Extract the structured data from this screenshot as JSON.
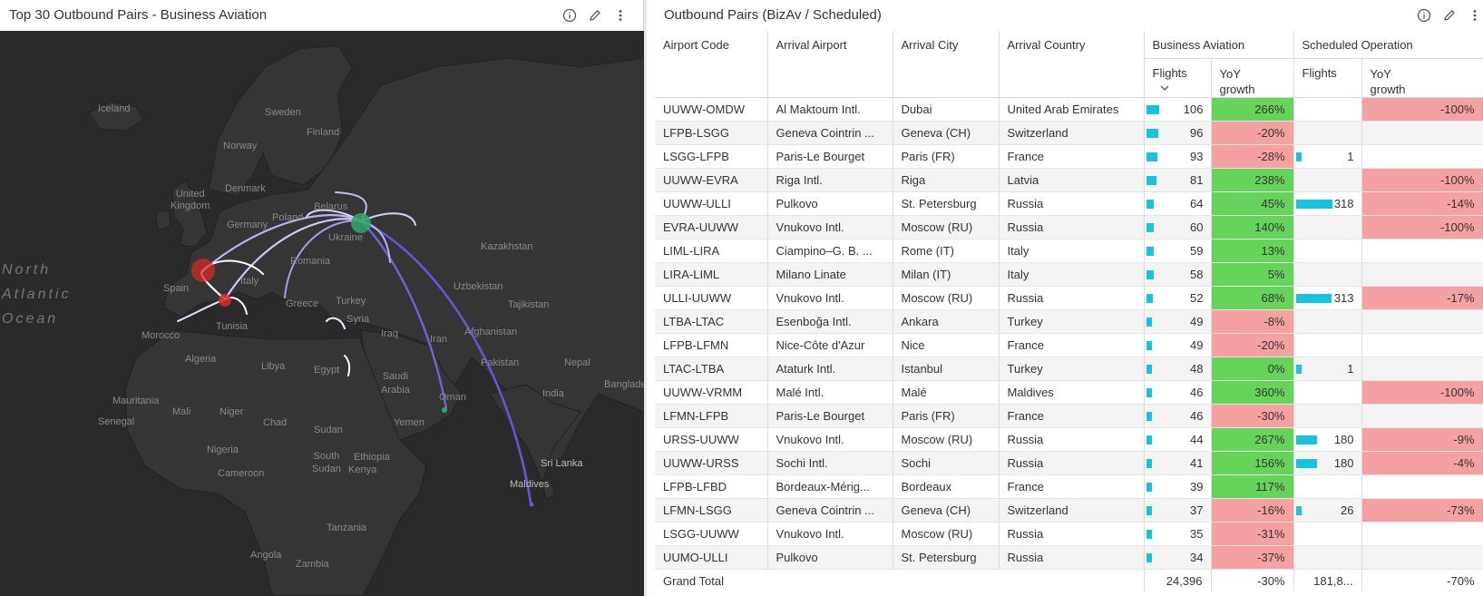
{
  "map_panel": {
    "title": "Top 30 Outbound Pairs - Business Aviation",
    "icons": [
      "info-icon",
      "edit-pencil-icon",
      "more-vertical-icon"
    ],
    "labels": {
      "north_atlantic_ocean": "North\nAtlantic\nOcean",
      "iceland": "Iceland",
      "sweden": "Sweden",
      "finland": "Finland",
      "norway": "Norway",
      "united_kingdom": "United\nKingdom",
      "denmark": "Denmark",
      "germany": "Germany",
      "poland": "Poland",
      "belarus": "Belarus",
      "ukraine": "Ukraine",
      "kazakhstan": "Kazakhstan",
      "romania": "Romania",
      "spain": "Spain",
      "italy": "Italy",
      "greece": "Greece",
      "turkey": "Turkey",
      "uzbekistan": "Uzbekistan",
      "tajikistan": "Tajikistan",
      "tunisia": "Tunisia",
      "morocco": "Morocco",
      "syria": "Syria",
      "iraq": "Iraq",
      "afghanistan": "Afghanistan",
      "iran": "Iran",
      "algeria": "Algeria",
      "libya": "Libya",
      "egypt": "Egypt",
      "saudi_arabia": "Saudi\nArabia",
      "pakistan": "Pakistan",
      "nepal": "Nepal",
      "oman": "Oman",
      "india": "India",
      "bangladesh": "Banglade",
      "mauritania": "Mauritania",
      "mali": "Mali",
      "niger": "Niger",
      "chad": "Chad",
      "senegal": "Senegal",
      "sudan": "Sudan",
      "yemen": "Yemen",
      "nigeria": "Nigeria",
      "south_sudan": "South\nSudan",
      "ethiopia": "Ethiopia",
      "cameroon": "Cameroon",
      "sri_lanka": "Sri Lanka",
      "maldives": "Maldives",
      "kenya": "Kenya",
      "tanzania": "Tanzania",
      "angola": "Angola",
      "zambia": "Zambia"
    },
    "colors": {
      "background": "#2a2a2a",
      "land": "#353535",
      "arc": "#8f86f0",
      "origin_moscow": "#2aa86a",
      "origin_west_europe": "#d42a2a"
    }
  },
  "table_panel": {
    "title": "Outbound Pairs (BizAv / Scheduled)",
    "icons": [
      "info-icon",
      "edit-pencil-icon",
      "more-vertical-icon"
    ],
    "headers": {
      "airport_code": "Airport Code",
      "arrival_airport": "Arrival Airport",
      "arrival_city": "Arrival City",
      "arrival_country": "Arrival Country",
      "business_aviation": "Business Aviation",
      "scheduled_operation": "Scheduled Operation",
      "flights": "Flights",
      "yoy_growth": "YoY\ngrowth"
    },
    "sort": "Flights descending",
    "rows": [
      {
        "code": "UUWW-OMDW",
        "airport": "Al Maktoum Intl.",
        "city": "Dubai",
        "country": "United Arab Emirates",
        "biz_flights": "106",
        "biz_flights_value": 106,
        "biz_yoy": "266%",
        "biz_yoy_sign": "pos",
        "sch_flights": "",
        "sch_flights_value": 0,
        "sch_yoy": "-100%",
        "sch_yoy_sign": "neg"
      },
      {
        "code": "LFPB-LSGG",
        "airport": "Geneva Cointrin ...",
        "city": "Geneva (CH)",
        "country": "Switzerland",
        "biz_flights": "96",
        "biz_flights_value": 96,
        "biz_yoy": "-20%",
        "biz_yoy_sign": "neg",
        "sch_flights": "",
        "sch_flights_value": 0,
        "sch_yoy": "",
        "sch_yoy_sign": ""
      },
      {
        "code": "LSGG-LFPB",
        "airport": "Paris-Le Bourget",
        "city": "Paris (FR)",
        "country": "France",
        "biz_flights": "93",
        "biz_flights_value": 93,
        "biz_yoy": "-28%",
        "biz_yoy_sign": "neg",
        "sch_flights": "1",
        "sch_flights_value": 1,
        "sch_yoy": "",
        "sch_yoy_sign": ""
      },
      {
        "code": "UUWW-EVRA",
        "airport": "Riga Intl.",
        "city": "Riga",
        "country": "Latvia",
        "biz_flights": "81",
        "biz_flights_value": 81,
        "biz_yoy": "238%",
        "biz_yoy_sign": "pos",
        "sch_flights": "",
        "sch_flights_value": 0,
        "sch_yoy": "-100%",
        "sch_yoy_sign": "neg"
      },
      {
        "code": "UUWW-ULLI",
        "airport": "Pulkovo",
        "city": "St. Petersburg",
        "country": "Russia",
        "biz_flights": "64",
        "biz_flights_value": 64,
        "biz_yoy": "45%",
        "biz_yoy_sign": "pos",
        "sch_flights": "318",
        "sch_flights_value": 318,
        "sch_yoy": "-14%",
        "sch_yoy_sign": "neg"
      },
      {
        "code": "EVRA-UUWW",
        "airport": "Vnukovo Intl.",
        "city": "Moscow (RU)",
        "country": "Russia",
        "biz_flights": "60",
        "biz_flights_value": 60,
        "biz_yoy": "140%",
        "biz_yoy_sign": "pos",
        "sch_flights": "",
        "sch_flights_value": 0,
        "sch_yoy": "-100%",
        "sch_yoy_sign": "neg"
      },
      {
        "code": "LIML-LIRA",
        "airport": "Ciampino–G. B. ...",
        "city": "Rome (IT)",
        "country": "Italy",
        "biz_flights": "59",
        "biz_flights_value": 59,
        "biz_yoy": "13%",
        "biz_yoy_sign": "pos",
        "sch_flights": "",
        "sch_flights_value": 0,
        "sch_yoy": "",
        "sch_yoy_sign": ""
      },
      {
        "code": "LIRA-LIML",
        "airport": "Milano Linate",
        "city": "Milan (IT)",
        "country": "Italy",
        "biz_flights": "58",
        "biz_flights_value": 58,
        "biz_yoy": "5%",
        "biz_yoy_sign": "pos",
        "sch_flights": "",
        "sch_flights_value": 0,
        "sch_yoy": "",
        "sch_yoy_sign": ""
      },
      {
        "code": "ULLI-UUWW",
        "airport": "Vnukovo Intl.",
        "city": "Moscow (RU)",
        "country": "Russia",
        "biz_flights": "52",
        "biz_flights_value": 52,
        "biz_yoy": "68%",
        "biz_yoy_sign": "pos",
        "sch_flights": "313",
        "sch_flights_value": 313,
        "sch_yoy": "-17%",
        "sch_yoy_sign": "neg"
      },
      {
        "code": "LTBA-LTAC",
        "airport": "Esenboğa Intl.",
        "city": "Ankara",
        "country": "Turkey",
        "biz_flights": "49",
        "biz_flights_value": 49,
        "biz_yoy": "-8%",
        "biz_yoy_sign": "neg",
        "sch_flights": "",
        "sch_flights_value": 0,
        "sch_yoy": "",
        "sch_yoy_sign": ""
      },
      {
        "code": "LFPB-LFMN",
        "airport": "Nice-Côte d'Azur",
        "city": "Nice",
        "country": "France",
        "biz_flights": "49",
        "biz_flights_value": 49,
        "biz_yoy": "-20%",
        "biz_yoy_sign": "neg",
        "sch_flights": "",
        "sch_flights_value": 0,
        "sch_yoy": "",
        "sch_yoy_sign": ""
      },
      {
        "code": "LTAC-LTBA",
        "airport": "Ataturk Intl.",
        "city": "Istanbul",
        "country": "Turkey",
        "biz_flights": "48",
        "biz_flights_value": 48,
        "biz_yoy": "0%",
        "biz_yoy_sign": "pos",
        "sch_flights": "1",
        "sch_flights_value": 1,
        "sch_yoy": "",
        "sch_yoy_sign": ""
      },
      {
        "code": "UUWW-VRMM",
        "airport": "Malé Intl.",
        "city": "Malé",
        "country": "Maldives",
        "biz_flights": "46",
        "biz_flights_value": 46,
        "biz_yoy": "360%",
        "biz_yoy_sign": "pos",
        "sch_flights": "",
        "sch_flights_value": 0,
        "sch_yoy": "-100%",
        "sch_yoy_sign": "neg"
      },
      {
        "code": "LFMN-LFPB",
        "airport": "Paris-Le Bourget",
        "city": "Paris (FR)",
        "country": "France",
        "biz_flights": "46",
        "biz_flights_value": 46,
        "biz_yoy": "-30%",
        "biz_yoy_sign": "neg",
        "sch_flights": "",
        "sch_flights_value": 0,
        "sch_yoy": "",
        "sch_yoy_sign": ""
      },
      {
        "code": "URSS-UUWW",
        "airport": "Vnukovo Intl.",
        "city": "Moscow (RU)",
        "country": "Russia",
        "biz_flights": "44",
        "biz_flights_value": 44,
        "biz_yoy": "267%",
        "biz_yoy_sign": "pos",
        "sch_flights": "180",
        "sch_flights_value": 180,
        "sch_yoy": "-9%",
        "sch_yoy_sign": "neg"
      },
      {
        "code": "UUWW-URSS",
        "airport": "Sochi Intl.",
        "city": "Sochi",
        "country": "Russia",
        "biz_flights": "41",
        "biz_flights_value": 41,
        "biz_yoy": "156%",
        "biz_yoy_sign": "pos",
        "sch_flights": "180",
        "sch_flights_value": 180,
        "sch_yoy": "-4%",
        "sch_yoy_sign": "neg"
      },
      {
        "code": "LFPB-LFBD",
        "airport": "Bordeaux-Mérig...",
        "city": "Bordeaux",
        "country": "France",
        "biz_flights": "39",
        "biz_flights_value": 39,
        "biz_yoy": "117%",
        "biz_yoy_sign": "pos",
        "sch_flights": "",
        "sch_flights_value": 0,
        "sch_yoy": "",
        "sch_yoy_sign": ""
      },
      {
        "code": "LFMN-LSGG",
        "airport": "Geneva Cointrin ...",
        "city": "Geneva (CH)",
        "country": "Switzerland",
        "biz_flights": "37",
        "biz_flights_value": 37,
        "biz_yoy": "-16%",
        "biz_yoy_sign": "neg",
        "sch_flights": "26",
        "sch_flights_value": 26,
        "sch_yoy": "-73%",
        "sch_yoy_sign": "neg"
      },
      {
        "code": "LSGG-UUWW",
        "airport": "Vnukovo Intl.",
        "city": "Moscow (RU)",
        "country": "Russia",
        "biz_flights": "35",
        "biz_flights_value": 35,
        "biz_yoy": "-31%",
        "biz_yoy_sign": "neg",
        "sch_flights": "",
        "sch_flights_value": 0,
        "sch_yoy": "",
        "sch_yoy_sign": ""
      },
      {
        "code": "UUMO-ULLI",
        "airport": "Pulkovo",
        "city": "St. Petersburg",
        "country": "Russia",
        "biz_flights": "34",
        "biz_flights_value": 34,
        "biz_yoy": "-37%",
        "biz_yoy_sign": "neg",
        "sch_flights": "",
        "sch_flights_value": 0,
        "sch_yoy": "",
        "sch_yoy_sign": ""
      }
    ],
    "grand_total": {
      "label": "Grand Total",
      "biz_flights": "24,396",
      "biz_yoy": "-30%",
      "sch_flights": "181,8...",
      "sch_yoy": "-70%"
    },
    "colors": {
      "bar": "#19c3e0",
      "positive": "#66d45a",
      "negative": "#f6a1a1"
    }
  }
}
